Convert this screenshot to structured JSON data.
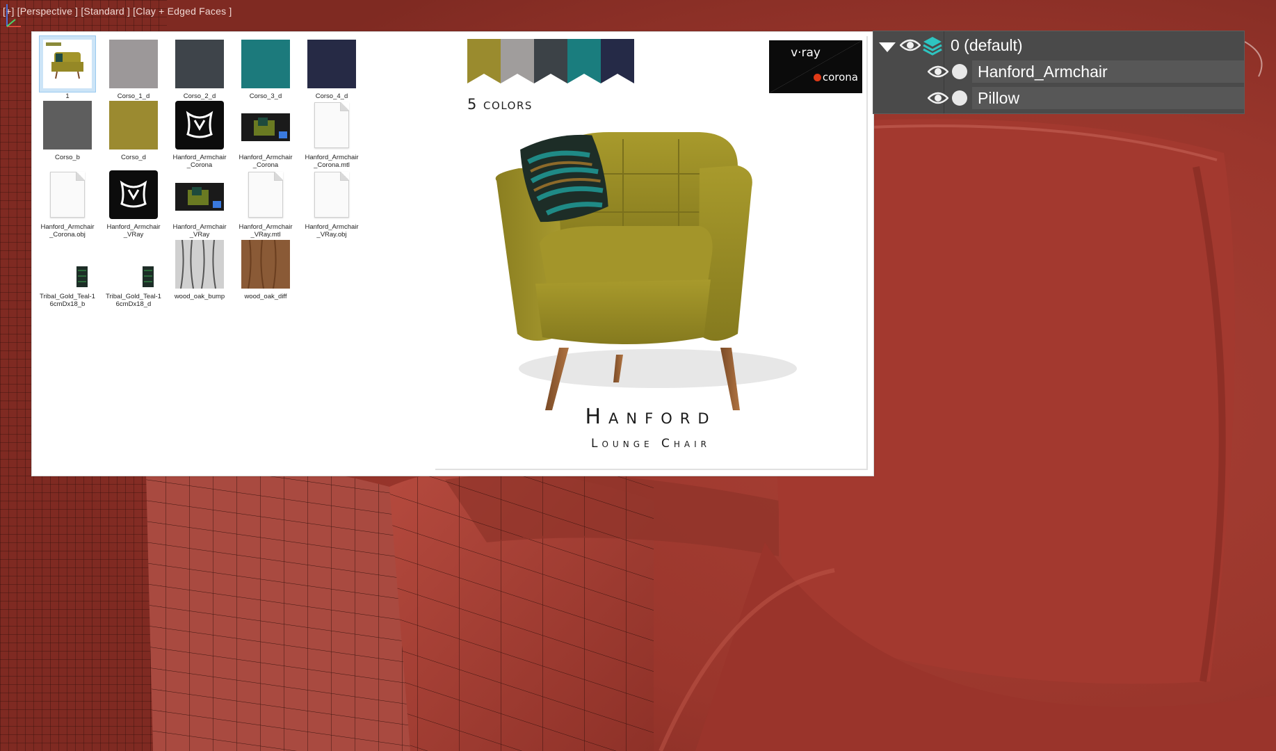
{
  "viewport": {
    "label": "[+] [Perspective ] [Standard ] [Clay + Edged Faces ]",
    "clay_color": "#a33a30"
  },
  "file_browser": {
    "items": [
      {
        "name": "1",
        "icon": "preview-thumbnail-icon",
        "selected": true
      },
      {
        "name": "Corso_1_d",
        "icon": "texture-thumbnail-icon",
        "color": "#9c9899"
      },
      {
        "name": "Corso_2_d",
        "icon": "texture-thumbnail-icon",
        "color": "#3e444a"
      },
      {
        "name": "Corso_3_d",
        "icon": "texture-thumbnail-icon",
        "color": "#1c7a7c"
      },
      {
        "name": "Corso_4_d",
        "icon": "texture-thumbnail-icon",
        "color": "#262a45"
      },
      {
        "name": "Corso_b",
        "icon": "texture-thumbnail-icon",
        "color": "#5e5e5e"
      },
      {
        "name": "Corso_d",
        "icon": "texture-thumbnail-icon",
        "color": "#9b8a30"
      },
      {
        "name": "Hanford_Armchair_Corona",
        "icon": "3dsmax-scene-icon"
      },
      {
        "name": "Hanford_Armchair_Corona",
        "icon": "render-thumbnail-icon"
      },
      {
        "name": "Hanford_Armchair_Corona.mtl",
        "icon": "document-icon"
      },
      {
        "name": "Hanford_Armchair_Corona.obj",
        "icon": "document-icon"
      },
      {
        "name": "Hanford_Armchair_VRay",
        "icon": "3dsmax-scene-icon"
      },
      {
        "name": "Hanford_Armchair_VRay",
        "icon": "render-thumbnail-icon"
      },
      {
        "name": "Hanford_Armchair_VRay.mtl",
        "icon": "document-icon"
      },
      {
        "name": "Hanford_Armchair_VRay.obj",
        "icon": "document-icon"
      },
      {
        "name": "Tribal_Gold_Teal-16cmDx18_b",
        "icon": "texture-thumbnail-icon"
      },
      {
        "name": "Tribal_Gold_Teal-16cmDx18_d",
        "icon": "texture-thumbnail-icon"
      },
      {
        "name": "wood_oak_bump",
        "icon": "texture-thumbnail-icon",
        "color": "#c9c9c9"
      },
      {
        "name": "wood_oak_diff",
        "icon": "texture-thumbnail-icon",
        "color": "#8a5a36"
      }
    ]
  },
  "preview": {
    "swatch_colors": [
      "#9a8b2e",
      "#a09d9c",
      "#3c4247",
      "#1a7d7e",
      "#252a47"
    ],
    "colors_label": "5 colors",
    "badge_vray": "v·ray",
    "badge_corona": "corona",
    "title": "Hanford",
    "subtitle": "Lounge Chair"
  },
  "layers": {
    "rows": [
      {
        "label": "0 (default)"
      },
      {
        "label": "Hanford_Armchair"
      },
      {
        "label": "Pillow"
      }
    ]
  }
}
